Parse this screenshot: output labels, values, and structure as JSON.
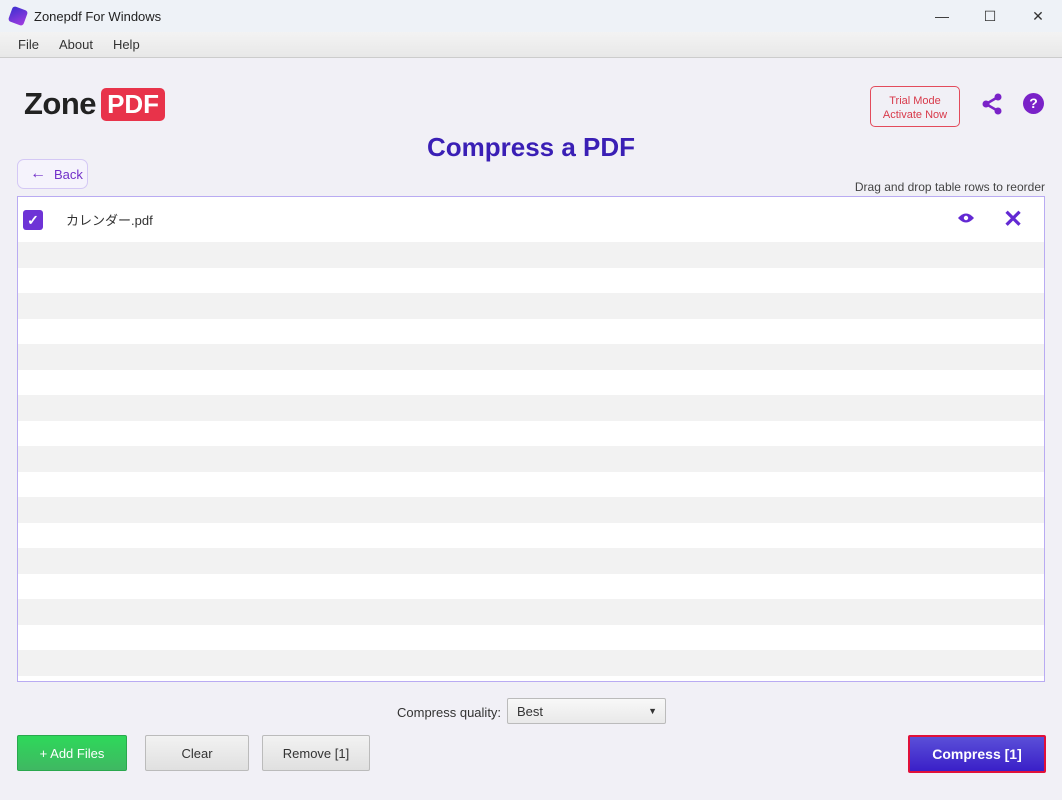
{
  "window": {
    "title": "Zonepdf For Windows",
    "minimize": "—",
    "maximize": "☐",
    "close": "✕"
  },
  "menu": [
    "File",
    "About",
    "Help"
  ],
  "logo": {
    "text": "Zone",
    "badge": "PDF"
  },
  "trial": {
    "line1": "Trial Mode",
    "line2": "Activate Now"
  },
  "page_title": "Compress a PDF",
  "back_label": "Back",
  "hint": "Drag and drop table rows to reorder",
  "files": [
    {
      "name": "カレンダー.pdf",
      "checked": true
    }
  ],
  "quality": {
    "label": "Compress quality:",
    "value": "Best"
  },
  "buttons": {
    "add": "+ Add Files",
    "clear": "Clear",
    "remove": "Remove [1]",
    "compress": "Compress [1]"
  },
  "colors": {
    "accent": "#3a1fb5",
    "brand_red": "#e8334a",
    "add_green": "#2ed85a"
  }
}
